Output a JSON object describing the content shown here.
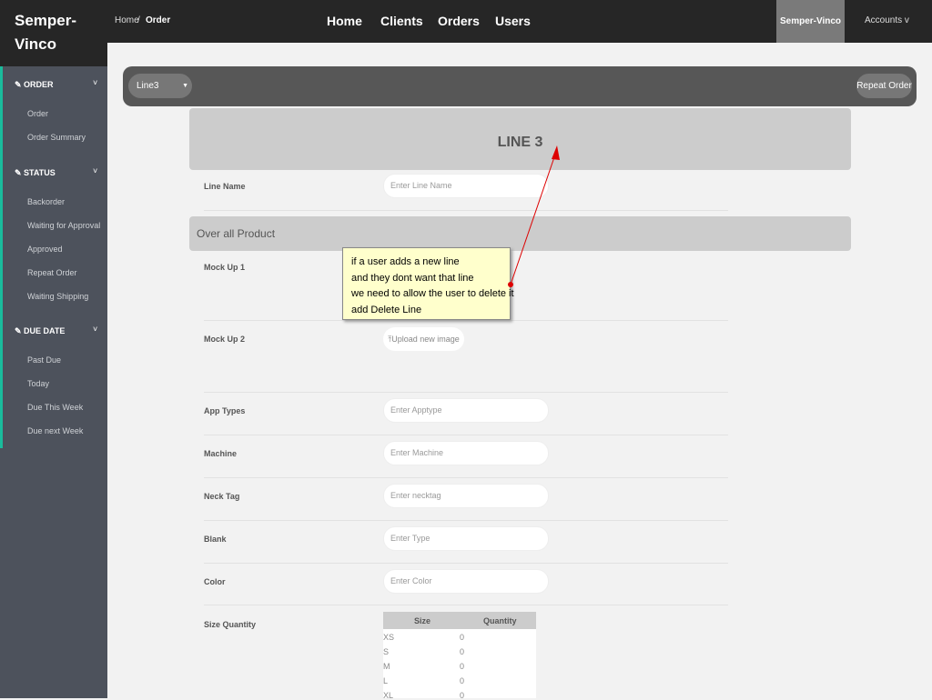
{
  "app": {
    "logo_line1": "Semper-",
    "logo_line2": "Vinco"
  },
  "breadcrumb": {
    "home": "Home",
    "sep": "/",
    "current": "Order"
  },
  "nav": [
    "Home",
    "Clients",
    "Orders",
    "Users"
  ],
  "user": {
    "brand": "Semper-Vinco",
    "accounts": "Accounts v"
  },
  "sidebar": {
    "sections": [
      {
        "title": "ORDER",
        "items": [
          "Order",
          "Order Summary"
        ]
      },
      {
        "title": "STATUS",
        "items": [
          "Backorder",
          "Waiting for Approval",
          "Approved",
          "Repeat Order",
          "Waiting Shipping"
        ]
      },
      {
        "title": "DUE DATE",
        "items": [
          "Past Due",
          "Today",
          "Due This Week",
          "Due next Week"
        ]
      }
    ]
  },
  "toolbar": {
    "line_select": "Line3",
    "repeat_order": "Repeat Order"
  },
  "line_title": "LINE 3",
  "form": {
    "line_name": {
      "label": "Line Name",
      "placeholder": "Enter Line Name"
    },
    "overall": "Over all Product",
    "mock1": "Mock Up 1",
    "mock2": "Mock Up 2",
    "upload": "Upload new image",
    "app_types": {
      "label": "App Types",
      "placeholder": "Enter Apptype"
    },
    "machine": {
      "label": "Machine",
      "placeholder": "Enter Machine"
    },
    "neck_tag": {
      "label": "Neck Tag",
      "placeholder": "Enter necktag"
    },
    "blank": {
      "label": "Blank",
      "placeholder": "Enter Type"
    },
    "color": {
      "label": "Color",
      "placeholder": "Enter Color"
    },
    "size_quantity": "Size Quantity"
  },
  "size_table": {
    "headers": [
      "Size",
      "Quantity"
    ],
    "rows": [
      [
        "XS",
        "0"
      ],
      [
        "S",
        "0"
      ],
      [
        "M",
        "0"
      ],
      [
        "L",
        "0"
      ],
      [
        "XL",
        "0"
      ]
    ]
  },
  "annotation": {
    "lines": [
      "if a user adds a new line",
      "and they dont want that line",
      "we need to allow the user to delete it",
      "add Delete Line"
    ]
  },
  "colors": {
    "accent": "#1abc9c",
    "arrow": "#dd0000"
  }
}
